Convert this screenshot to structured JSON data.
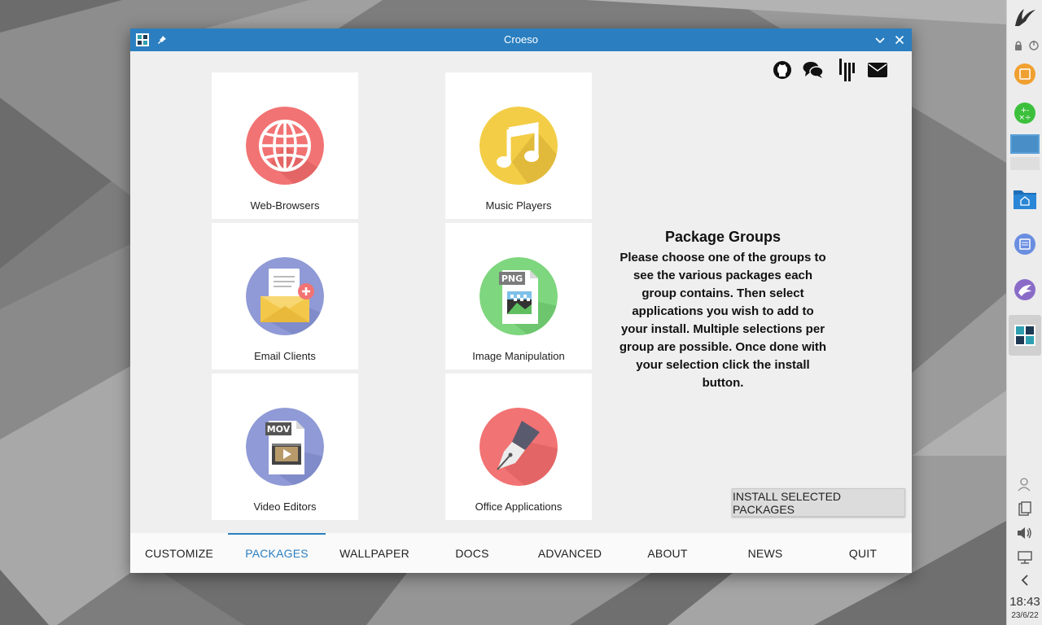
{
  "window": {
    "title": "Croeso"
  },
  "groups": [
    {
      "label": "Web-Browsers",
      "icon": "globe-icon",
      "color": "#f27373"
    },
    {
      "label": "Music Players",
      "icon": "music-note-icon",
      "color": "#f3cd45"
    },
    {
      "label": "Email Clients",
      "icon": "envelope-icon",
      "color": "#8f9ad6"
    },
    {
      "label": "Image Manipulation",
      "icon": "png-file-icon",
      "color": "#7ed67e"
    },
    {
      "label": "Video Editors",
      "icon": "mov-file-icon",
      "color": "#8f9ad6"
    },
    {
      "label": "Office Applications",
      "icon": "fountain-pen-icon",
      "color": "#f27373"
    }
  ],
  "social": [
    "github-icon",
    "chat-icon",
    "gitter-icon",
    "mail-icon"
  ],
  "info": {
    "heading": "Package Groups",
    "text": "Please choose one of the groups to see the various packages each group contains. Then select applications you wish to add to your install. Multiple selections per group are possible. Once done with your selection click the install button."
  },
  "install_button": "INSTALL SELECTED PACKAGES",
  "tabs": [
    "CUSTOMIZE",
    "PACKAGES",
    "WALLPAPER",
    "DOCS",
    "ADVANCED",
    "ABOUT",
    "NEWS",
    "QUIT"
  ],
  "active_tab": "PACKAGES",
  "panel": {
    "time": "18:43",
    "date": "23/6/22"
  },
  "colors": {
    "accent": "#2b7fc0",
    "title_bar": "#2b7fc0"
  },
  "png_badge": "PNG",
  "mov_badge": "MOV"
}
